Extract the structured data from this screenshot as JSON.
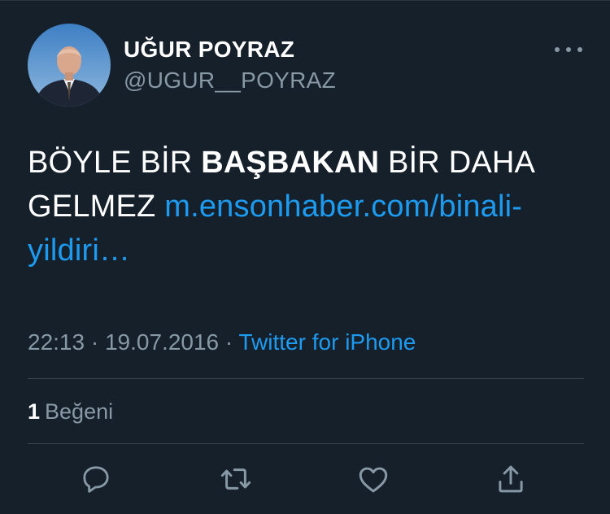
{
  "author": {
    "display_name": "UĞUR POYRAZ",
    "handle": "@UGUR__POYRAZ"
  },
  "tweet": {
    "text_part1": "BÖYLE BİR ",
    "text_bold": "BAŞBAKAN",
    "text_part2": " BİR DAHA GELMEZ ",
    "link_text": "m.ensonhaber.com/binali-yildiri…"
  },
  "meta": {
    "time": "22:13",
    "separator1": " · ",
    "date": "19.07.2016",
    "separator2": " · ",
    "source": "Twitter for iPhone"
  },
  "stats": {
    "likes_count": "1",
    "likes_label": "Beğeni"
  },
  "icons": {
    "more": "more-horizontal-icon",
    "reply": "reply-icon",
    "retweet": "retweet-icon",
    "like": "heart-icon",
    "share": "share-icon"
  },
  "colors": {
    "background": "#15202b",
    "text_primary": "#ffffff",
    "text_secondary": "#8899a6",
    "link": "#1d9bf0",
    "divider": "#38444d"
  }
}
